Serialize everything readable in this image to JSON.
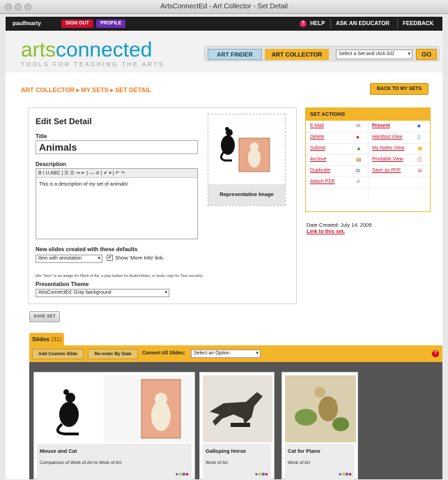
{
  "window": {
    "title": "ArtsConnectEd - Art Collector - Set Detail"
  },
  "topbar": {
    "username": "paulfmarty",
    "signout": "SIGN OUT",
    "profile": "PROFILE",
    "help": "HELP",
    "ask": "ASK AN EDUCATOR",
    "feedback": "FEEDBACK"
  },
  "header": {
    "logo_a": "arts",
    "logo_b": "connected",
    "tagline": "TOOLS FOR TEACHING THE ARTS",
    "finder": "ART FINDER",
    "collector": "ART COLLECTOR",
    "set_select": "Select a Set and click GO",
    "go": "GO"
  },
  "breadcrumb": "ART COLLECTOR ▸ MY SETS ▸ SET DETAIL",
  "back_button": "BACK TO MY SETS",
  "edit": {
    "heading": "Edit Set Detail",
    "title_label": "Title",
    "title_value": "Animals",
    "desc_label": "Description",
    "desc_toolbar": "B  I  U  ABC  |  ☰  ☰  ⇥  ⇤  |  —  ⊘  |  ✔ ▾  |  ↶  ↷",
    "desc_value": "This is a description of my set of animals!",
    "rep_caption": "Representative Image",
    "defaults_label": "New slides created with these defaults",
    "defaults_value": "Item with annotation",
    "show_more": "Show 'More Info' link.",
    "note": "(An \"Item\" is an image for Work of Art, a play button for Audio/Video, or body copy for Text records)",
    "theme_label": "Presentation Theme",
    "theme_value": "ArtsConnectEd: Gray background"
  },
  "save_button": "SAVE SET",
  "set_actions": {
    "header": "SET ACTIONS",
    "left": [
      "E-Mail",
      "Delete",
      "Submit",
      "Archive",
      "Duplicate",
      "Attach PDF"
    ],
    "right": [
      "Present",
      "Handout View",
      "My Notes View",
      "Printable View",
      "Save as PDF"
    ]
  },
  "date_created": "Date Created: July 14, 2009",
  "link_to_set": "Link to this set.",
  "slides": {
    "tab_label": "Slides",
    "count": "(31)",
    "add_custom": "Add Custom Slide",
    "reorder": "Re-order By Date",
    "convert_label": "Convert All Slides:",
    "convert_select": "Select an Option"
  },
  "cards": [
    {
      "title": "Mouse and Cat",
      "desc": "Comparison of Work of Art to Work of Art"
    },
    {
      "title": "Galloping Horse",
      "desc": "Work of Art"
    },
    {
      "title": "Cat for Piano",
      "desc": "Work of Art"
    }
  ],
  "colors": {
    "accent": "#f3b52a",
    "link": "#c8102e",
    "logo_green": "#8cbd2b",
    "logo_blue": "#0e9bc9"
  }
}
